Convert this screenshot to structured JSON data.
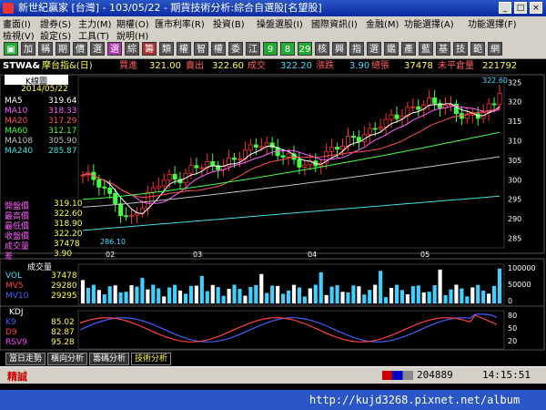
{
  "window": {
    "title": "新世紀贏家 [台灣] - 103/05/22 - 期貨技術分析:綜合自選股[名望股]",
    "min": "_",
    "max": "□",
    "close": "×"
  },
  "menubar": {
    "row1": [
      "畫面(I)",
      "證券(S)",
      "主力(M)",
      "期權(O)",
      "匯市利率(R)",
      "投資(B)",
      "操盤選股(I)",
      "國際資訊(I)",
      "金融(M)",
      "功能選擇(A)",
      "功能選擇(F)"
    ],
    "row2": [
      "檢視(V)",
      "設定(S)",
      "工具(T)",
      "說明(H)"
    ]
  },
  "toolbar": {
    "buttons": [
      {
        "t": "▣",
        "c": "#2a3"
      },
      {
        "t": "加",
        "c": "#555"
      },
      {
        "t": "稱",
        "c": "#555"
      },
      {
        "t": "期",
        "c": "#555"
      },
      {
        "t": "價",
        "c": "#555"
      },
      {
        "t": "選",
        "c": "#555"
      },
      {
        "t": "選",
        "c": "#a3a"
      },
      {
        "t": "綜",
        "c": "#555"
      },
      {
        "t": "籌",
        "c": "#a33"
      },
      {
        "t": "類",
        "c": "#555"
      },
      {
        "t": "權",
        "c": "#555"
      },
      {
        "t": "智",
        "c": "#555"
      },
      {
        "t": "權",
        "c": "#555"
      },
      {
        "t": "委",
        "c": "#555"
      },
      {
        "t": "江",
        "c": "#555"
      },
      {
        "t": "9",
        "c": "#2a3"
      },
      {
        "t": "8",
        "c": "#2a3"
      },
      {
        "t": "29",
        "c": "#2a3"
      },
      {
        "t": "核",
        "c": "#555"
      },
      {
        "t": "興",
        "c": "#555"
      },
      {
        "t": "指",
        "c": "#555"
      },
      {
        "t": "選",
        "c": "#555"
      },
      {
        "t": "鑑",
        "c": "#555"
      },
      {
        "t": "產",
        "c": "#555"
      },
      {
        "t": "藍",
        "c": "#555"
      },
      {
        "t": "基",
        "c": "#555"
      },
      {
        "t": "技",
        "c": "#555"
      },
      {
        "t": "範",
        "c": "#555"
      },
      {
        "t": "網",
        "c": "#555"
      }
    ]
  },
  "quote": {
    "symbol": "STWA&",
    "name": "摩台指&(日)",
    "buy_label": "買進",
    "buy": "321.00",
    "sell_label": "賣出",
    "sell": "322.60",
    "deal_label": "成交",
    "deal": "322.20",
    "change_label": "漲跌",
    "change": "3.90",
    "vol_label": "總張",
    "vol": "37478",
    "oi_label": "未平倉量",
    "oi": "221792"
  },
  "kpanel": {
    "title": "K線圖",
    "date": "2014/05/22",
    "ma": [
      {
        "name": "MA5",
        "value": "319.64",
        "color": "#ffffff"
      },
      {
        "name": "MA10",
        "value": "318.33",
        "color": "#ff60ff"
      },
      {
        "name": "MA20",
        "value": "317.29",
        "color": "#ff5050"
      },
      {
        "name": "MA60",
        "value": "312.17",
        "color": "#40ff40"
      },
      {
        "name": "MA108",
        "value": "305.90",
        "color": "#c0c0c0"
      },
      {
        "name": "MA240",
        "value": "285.87",
        "color": "#40e0e0"
      }
    ],
    "ohlc": [
      {
        "name": "開盤價",
        "value": "319.10"
      },
      {
        "name": "最高價",
        "value": "322.60"
      },
      {
        "name": "最低價",
        "value": "318.90"
      },
      {
        "name": "收盤價",
        "value": "322.20"
      },
      {
        "name": "成交量",
        "value": "37478"
      },
      {
        "name": "差",
        "value": "3.90"
      }
    ],
    "high_mark": "322.60",
    "low_mark": "286.10",
    "months": [
      "02",
      "03",
      "04",
      "05"
    ]
  },
  "volpanel": {
    "title": "成交量",
    "lines": [
      {
        "name": "VOL",
        "value": "37478",
        "color": "#40e0ff"
      },
      {
        "name": "MV5",
        "value": "29280",
        "color": "#ff4040"
      },
      {
        "name": "MV10",
        "value": "29295",
        "color": "#4060ff"
      }
    ]
  },
  "kdpanel": {
    "title": "KDJ",
    "lines": [
      {
        "name": "K9",
        "value": "85.02",
        "color": "#4060ff"
      },
      {
        "name": "D9",
        "value": "82.87",
        "color": "#ff4040"
      },
      {
        "name": "RSV9",
        "value": "95.28",
        "color": "#ff40ff"
      }
    ]
  },
  "tabs": [
    "當日走勢",
    "橫向分析",
    "籌碼分析",
    "技術分析"
  ],
  "status": {
    "left": "精誠",
    "counter": "204889",
    "time": "14:15:51"
  },
  "watermark": "http://kujd3268.pixnet.net/album",
  "chart_data": [
    {
      "type": "candlestick",
      "title": "",
      "ylim": [
        283,
        326
      ],
      "y_ticks": [
        285,
        290,
        295,
        300,
        305,
        310,
        315,
        320,
        325
      ],
      "x_month_labels": [
        "02",
        "03",
        "04",
        "05"
      ],
      "series": [
        {
          "name": "MA5",
          "color": "#ffffff"
        },
        {
          "name": "MA10",
          "color": "#ff60ff"
        },
        {
          "name": "MA20",
          "color": "#ff5050"
        },
        {
          "name": "MA60",
          "color": "#40ff40"
        },
        {
          "name": "MA108",
          "color": "#c0c0c0"
        },
        {
          "name": "MA240",
          "color": "#40e0e0"
        }
      ]
    },
    {
      "type": "bar",
      "title": "成交量",
      "y_ticks": [
        "100000",
        "50000",
        "0"
      ],
      "ylim": [
        0,
        120000
      ]
    },
    {
      "type": "line",
      "title": "KDJ",
      "y_ticks": [
        "80",
        "50",
        "20"
      ],
      "ylim": [
        0,
        100
      ]
    }
  ]
}
